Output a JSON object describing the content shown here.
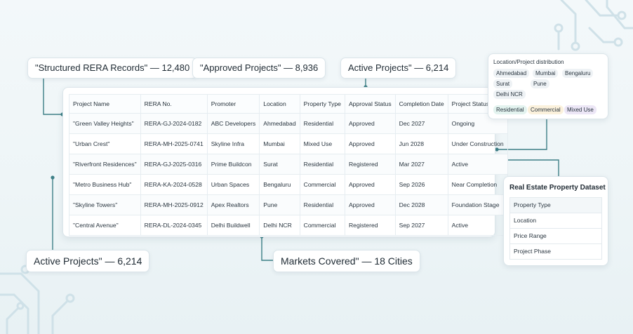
{
  "callouts": {
    "structured_records": "\"Structured RERA Records\" — 12,480",
    "approved_projects": "\"Approved Projects\" — 8,936",
    "active_projects_top": "Active Projects\" — 6,214",
    "active_projects_bottom": "Active Projects\" — 6,214",
    "markets_covered": "Markets Covered\" — 18 Cities"
  },
  "table": {
    "headers": [
      "Project Name",
      "RERA No.",
      "Promoter",
      "Location",
      "Property Type",
      "Approval Status",
      "Completion Date",
      "Project Status"
    ],
    "rows": [
      [
        "\"Green Valley Heights\"",
        "RERA-GJ-2024-0182",
        "ABC Developers",
        "Ahmedabad",
        "Residential",
        "Approved",
        "Dec 2027",
        "Ongoing"
      ],
      [
        "\"Urban Crest\"",
        "RERA-MH-2025-0741",
        "Skyline Infra",
        "Mumbai",
        "Mixed Use",
        "Approved",
        "Jun 2028",
        "Under Construction"
      ],
      [
        "\"Riverfront Residences\"",
        "RERA-GJ-2025-0316",
        "Prime Buildcon",
        "Surat",
        "Residential",
        "Registered",
        "Mar 2027",
        "Active"
      ],
      [
        "\"Metro Business Hub\"",
        "RERA-KA-2024-0528",
        "Urban Spaces",
        "Bengaluru",
        "Commercial",
        "Approved",
        "Sep 2026",
        "Near Completion"
      ],
      [
        "\"Skyline Towers\"",
        "RERA-MH-2025-0912",
        "Apex Realtors",
        "Pune",
        "Residential",
        "Approved",
        "Dec 2028",
        "Foundation Stage"
      ],
      [
        "\"Central Avenue\"",
        "RERA-DL-2024-0345",
        "Delhi Buildwell",
        "Delhi NCR",
        "Commercial",
        "Registered",
        "Sep 2027",
        "Active"
      ]
    ]
  },
  "distribution": {
    "title": "Location/Project distribution",
    "locations": [
      "Ahmedabad",
      "Mumbai",
      "Bengaluru",
      "Surat",
      "Pune",
      "Delhi NCR"
    ],
    "types": [
      {
        "label": "Residential",
        "color": "#e3f3ef"
      },
      {
        "label": "Commercial",
        "color": "#fbf1dc"
      },
      {
        "label": "Mixed Use",
        "color": "#ece6f6"
      }
    ]
  },
  "dataset": {
    "title": "Real Estate Property Dataset",
    "items": [
      "Property Type",
      "Location",
      "Price Range",
      "Project Phase"
    ]
  },
  "colors": {
    "connector": "#3d7f86",
    "circuit": "#c9dde6"
  }
}
